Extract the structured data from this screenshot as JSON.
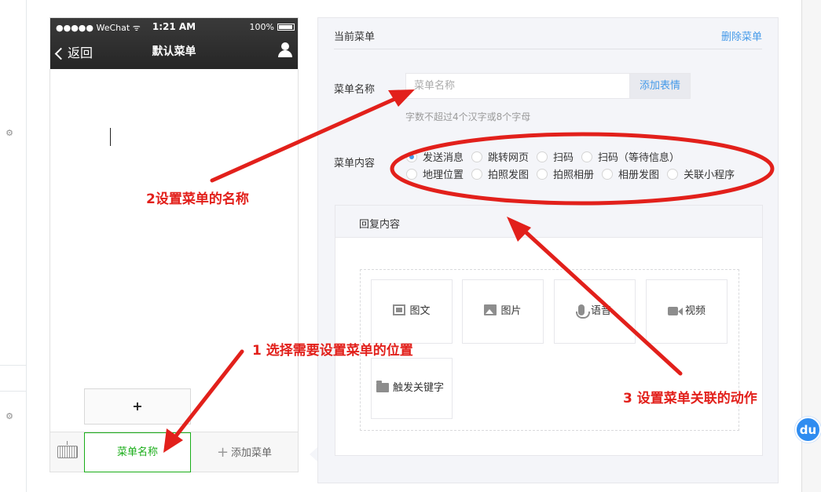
{
  "colors": {
    "accent_green": "#1aad19",
    "link_blue": "#459ae9",
    "annotation_red": "#e2201b",
    "phone_nav_dark": "#2e2e2e"
  },
  "phone": {
    "status_bar": {
      "carrier": "●●●●● WeChat ᯤ",
      "time": "1:21 AM",
      "battery": "100%"
    },
    "nav": {
      "back_label": "返回",
      "title": "默认菜单",
      "user_icon": "user-icon"
    },
    "plus_label": "+",
    "bottom_menu": {
      "keyboard_icon": "keyboard-icon",
      "active_item": "菜单名称",
      "add_item": "添加菜单",
      "add_prefix": "+"
    }
  },
  "editor": {
    "title": "当前菜单",
    "delete_link": "删除菜单",
    "name_label": "菜单名称",
    "name_placeholder": "菜单名称",
    "emoji_button": "添加表情",
    "name_hint": "字数不超过4个汉字或8个字母",
    "content_label": "菜单内容",
    "content_options": [
      {
        "label": "发送消息",
        "selected": true
      },
      {
        "label": "跳转网页",
        "selected": false
      },
      {
        "label": "扫码",
        "selected": false
      },
      {
        "label": "扫码（等待信息）",
        "selected": false
      },
      {
        "label": "地理位置",
        "selected": false
      },
      {
        "label": "拍照发图",
        "selected": false
      },
      {
        "label": "拍照相册",
        "selected": false
      },
      {
        "label": "相册发图",
        "selected": false
      },
      {
        "label": "关联小程序",
        "selected": false
      }
    ],
    "reply": {
      "title": "回复内容",
      "types": [
        {
          "label": "图文",
          "icon": "news-icon"
        },
        {
          "label": "图片",
          "icon": "image-icon"
        },
        {
          "label": "语音",
          "icon": "voice-icon"
        },
        {
          "label": "视频",
          "icon": "video-icon"
        },
        {
          "label": "触发关键字",
          "icon": "folder-icon"
        }
      ]
    }
  },
  "annotations": {
    "step1": "1 选择需要设置菜单的位置",
    "step2": "2设置菜单的名称",
    "step3": "3 设置菜单关联的动作"
  },
  "badge": "du"
}
